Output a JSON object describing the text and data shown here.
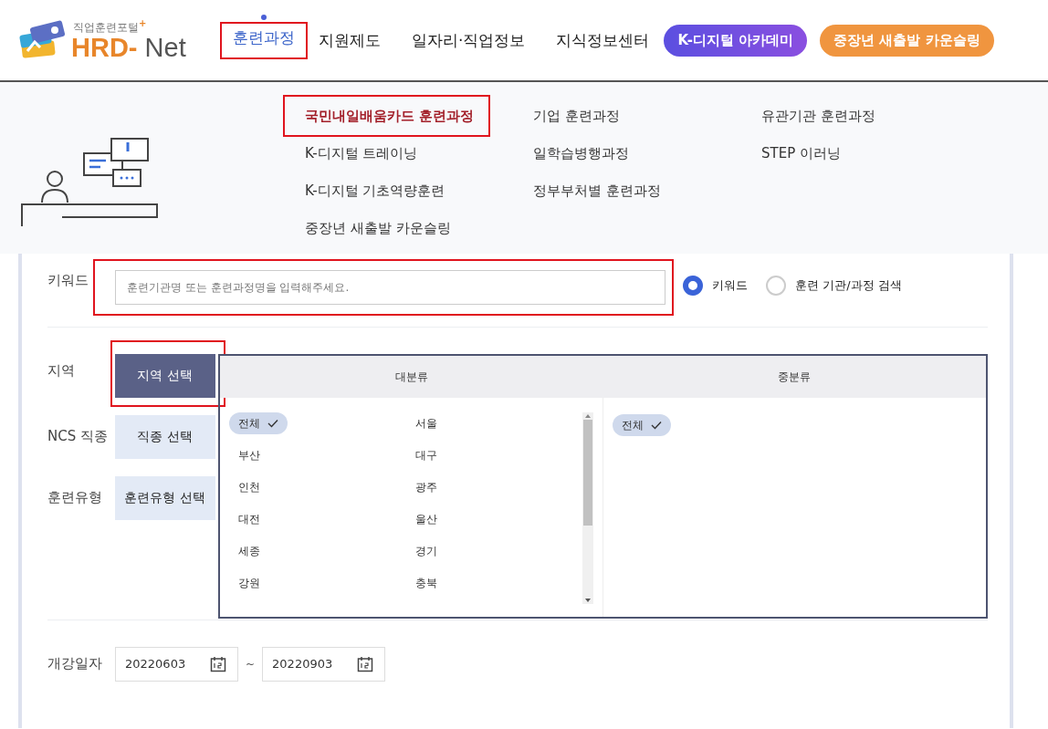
{
  "logo": {
    "tagline": "직업훈련포털",
    "tagline_mark": "+",
    "name_1": "HRD-",
    "name_2": "Net"
  },
  "nav": [
    {
      "label": "훈련과정",
      "selected": true,
      "highlighted": true
    },
    {
      "label": "지원제도",
      "selected": false,
      "highlighted": false
    },
    {
      "label": "일자리·직업정보",
      "selected": false,
      "highlighted": false
    },
    {
      "label": "지식정보센터",
      "selected": false,
      "highlighted": false
    }
  ],
  "nav_buttons": [
    {
      "label": "K-디지털 아카데미",
      "kind": "purple"
    },
    {
      "label": "중장년 새출발 카운슬링",
      "kind": "orange"
    }
  ],
  "submenu": [
    [
      {
        "label": "국민내일배움카드 훈련과정",
        "highlighted": true
      },
      {
        "label": "K-디지털 트레이닝",
        "highlighted": false
      },
      {
        "label": "K-디지털 기초역량훈련",
        "highlighted": false
      },
      {
        "label": "중장년 새출발 카운슬링",
        "highlighted": false
      }
    ],
    [
      {
        "label": "기업 훈련과정",
        "highlighted": false
      },
      {
        "label": "일학습병행과정",
        "highlighted": false
      },
      {
        "label": "정부부처별 훈련과정",
        "highlighted": false
      }
    ],
    [
      {
        "label": "유관기관 훈련과정",
        "highlighted": false
      },
      {
        "label": "STEP 이러닝",
        "highlighted": false
      }
    ]
  ],
  "keyword": {
    "label": "키워드",
    "placeholder": "훈련기관명 또는 훈련과정명을 입력해주세요.",
    "highlighted": true,
    "options": [
      {
        "label": "키워드",
        "selected": true
      },
      {
        "label": "훈련 기관/과정 검색",
        "selected": false
      }
    ]
  },
  "filters": [
    {
      "label": "지역",
      "button": "지역 선택",
      "selected": true,
      "highlighted": true
    },
    {
      "label": "NCS 직종",
      "button": "직종 선택",
      "selected": false,
      "highlighted": false
    },
    {
      "label": "훈련유형",
      "button": "훈련유형 선택",
      "selected": false,
      "highlighted": false
    }
  ],
  "region_panel": {
    "columns": [
      "대분류",
      "중분류"
    ],
    "major": [
      {
        "label": "전체",
        "selected": true
      },
      {
        "label": "서울",
        "selected": false
      },
      {
        "label": "부산",
        "selected": false
      },
      {
        "label": "대구",
        "selected": false
      },
      {
        "label": "인천",
        "selected": false
      },
      {
        "label": "광주",
        "selected": false
      },
      {
        "label": "대전",
        "selected": false
      },
      {
        "label": "울산",
        "selected": false
      },
      {
        "label": "세종",
        "selected": false
      },
      {
        "label": "경기",
        "selected": false
      },
      {
        "label": "강원",
        "selected": false
      },
      {
        "label": "충북",
        "selected": false
      }
    ],
    "minor": [
      {
        "label": "전체",
        "selected": true
      }
    ]
  },
  "date": {
    "label": "개강일자",
    "from": "20220603",
    "separator": "~",
    "to": "20220903"
  }
}
